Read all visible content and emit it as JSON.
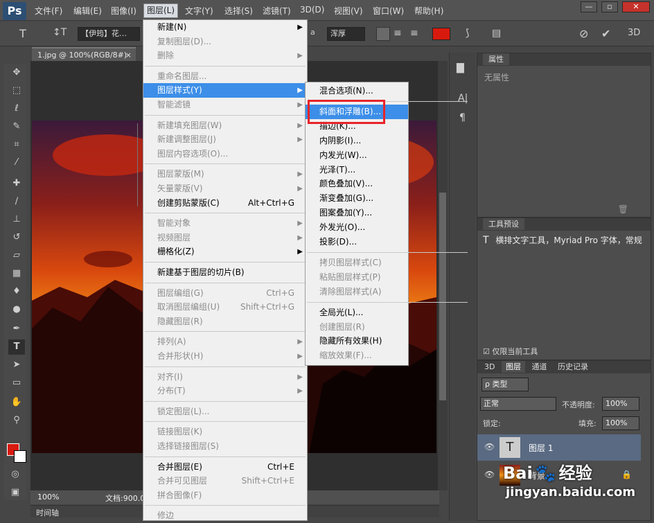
{
  "app": {
    "logo": "Ps"
  },
  "menubar": {
    "items": [
      "文件(F)",
      "编辑(E)",
      "图像(I)",
      "图层(L)",
      "文字(Y)",
      "选择(S)",
      "滤镜(T)",
      "3D(D)",
      "视图(V)",
      "窗口(W)",
      "帮助(H)"
    ],
    "window_buttons": [
      "—",
      "▫",
      "✕"
    ]
  },
  "options_bar": {
    "font_family": "【伊筠】花…",
    "aa_label": "a",
    "aa_value": "浑厚",
    "color": "#d81a0e",
    "threed": "3D"
  },
  "document": {
    "tab_title": "1.jpg @ 100%(RGB/8#)",
    "close": "×",
    "zoom": "100%",
    "doc_info": "文档:900.0",
    "timeline_label": "时间轴"
  },
  "layer_menu": {
    "groups": [
      [
        {
          "label": "新建(N)",
          "arrow": true
        },
        {
          "label": "复制图层(D)...",
          "disabled": true
        },
        {
          "label": "删除",
          "disabled": true,
          "arrow": true
        }
      ],
      [
        {
          "label": "重命名图层...",
          "disabled": true
        },
        {
          "label": "图层样式(Y)",
          "arrow": true,
          "highlight": true
        },
        {
          "label": "智能滤镜",
          "disabled": true,
          "arrow": true
        }
      ],
      [
        {
          "label": "新建填充图层(W)",
          "disabled": true,
          "arrow": true
        },
        {
          "label": "新建调整图层(J)",
          "disabled": true,
          "arrow": true
        },
        {
          "label": "图层内容选项(O)...",
          "disabled": true
        }
      ],
      [
        {
          "label": "图层蒙版(M)",
          "disabled": true,
          "arrow": true
        },
        {
          "label": "矢量蒙版(V)",
          "disabled": true,
          "arrow": true
        },
        {
          "label": "创建剪贴蒙版(C)",
          "shortcut": "Alt+Ctrl+G"
        }
      ],
      [
        {
          "label": "智能对象",
          "disabled": true,
          "arrow": true
        },
        {
          "label": "视频图层",
          "disabled": true,
          "arrow": true
        },
        {
          "label": "栅格化(Z)",
          "arrow": true
        }
      ],
      [
        {
          "label": "新建基于图层的切片(B)"
        }
      ],
      [
        {
          "label": "图层编组(G)",
          "disabled": true,
          "shortcut": "Ctrl+G"
        },
        {
          "label": "取消图层编组(U)",
          "disabled": true,
          "shortcut": "Shift+Ctrl+G"
        },
        {
          "label": "隐藏图层(R)",
          "disabled": true
        }
      ],
      [
        {
          "label": "排列(A)",
          "disabled": true,
          "arrow": true
        },
        {
          "label": "合并形状(H)",
          "disabled": true,
          "arrow": true
        }
      ],
      [
        {
          "label": "对齐(I)",
          "disabled": true,
          "arrow": true
        },
        {
          "label": "分布(T)",
          "disabled": true,
          "arrow": true
        }
      ],
      [
        {
          "label": "锁定图层(L)...",
          "disabled": true
        }
      ],
      [
        {
          "label": "链接图层(K)",
          "disabled": true
        },
        {
          "label": "选择链接图层(S)",
          "disabled": true
        }
      ],
      [
        {
          "label": "合并图层(E)",
          "shortcut": "Ctrl+E"
        },
        {
          "label": "合并可见图层",
          "disabled": true,
          "shortcut": "Shift+Ctrl+E"
        },
        {
          "label": "拼合图像(F)",
          "disabled": true
        }
      ],
      [
        {
          "label": "修边",
          "disabled": true
        }
      ]
    ]
  },
  "style_submenu": {
    "groups": [
      [
        {
          "label": "混合选项(N)..."
        }
      ],
      [
        {
          "label": "斜面和浮雕(B)...",
          "highlight": true
        },
        {
          "label": "描边(K)..."
        },
        {
          "label": "内阴影(I)..."
        },
        {
          "label": "内发光(W)..."
        },
        {
          "label": "光泽(T)..."
        },
        {
          "label": "颜色叠加(V)..."
        },
        {
          "label": "渐变叠加(G)..."
        },
        {
          "label": "图案叠加(Y)..."
        },
        {
          "label": "外发光(O)..."
        },
        {
          "label": "投影(D)..."
        }
      ],
      [
        {
          "label": "拷贝图层样式(C)",
          "disabled": true
        },
        {
          "label": "粘贴图层样式(P)",
          "disabled": true
        },
        {
          "label": "清除图层样式(A)",
          "disabled": true
        }
      ],
      [
        {
          "label": "全局光(L)..."
        },
        {
          "label": "创建图层(R)",
          "disabled": true
        },
        {
          "label": "隐藏所有效果(H)"
        },
        {
          "label": "缩放效果(F)...",
          "disabled": true
        }
      ]
    ]
  },
  "properties_panel": {
    "title": "属性",
    "empty": "无属性"
  },
  "presets_panel": {
    "title": "工具预设",
    "item": "横排文字工具，Myriad Pro 字体，常规",
    "checkbox": "仅限当前工具"
  },
  "layers_panel": {
    "tabs": [
      "3D",
      "图层",
      "通道",
      "历史记录"
    ],
    "filter": "ρ 类型",
    "blend_mode": "正常",
    "opacity_label": "不透明度:",
    "opacity": "100%",
    "lock_label": "锁定:",
    "fill_label": "填充:",
    "fill": "100%",
    "layers": [
      {
        "name": "图层 1",
        "type": "text"
      },
      {
        "name": "背景",
        "type": "image"
      }
    ]
  },
  "watermark": {
    "brand": "Bai",
    "brand2": "经验",
    "url": "jingyan.baidu.com"
  }
}
